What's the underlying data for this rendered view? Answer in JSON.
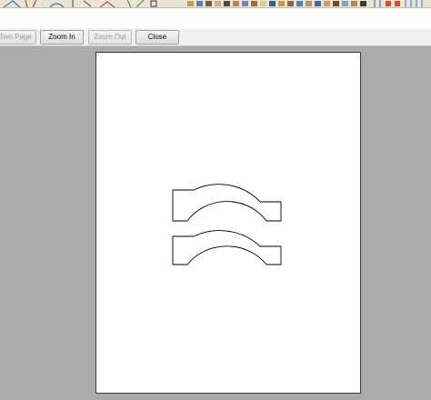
{
  "toolbar": {
    "two_page_label": "Two Page",
    "zoom_in_label": "Zoom In",
    "zoom_out_label": "Zoom Out",
    "close_label": "Close"
  },
  "colors": {
    "workspace_bg": "#ababab",
    "page_bg": "#ffffff",
    "outline": "#000000"
  },
  "preview": {
    "shapes": [
      "arch-bracket",
      "arch-bracket"
    ]
  }
}
